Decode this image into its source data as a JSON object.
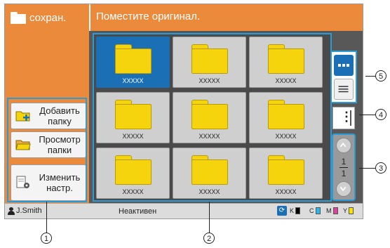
{
  "header": {
    "box_title": "сохран.",
    "message": "Поместите оригинал."
  },
  "sidebar": {
    "buttons": [
      {
        "label": "Добавить папку",
        "icon": "folder-add-icon"
      },
      {
        "label": "Просмотр папки",
        "icon": "folder-open-icon"
      },
      {
        "label": "Изменить настр.",
        "icon": "settings-document-icon"
      }
    ]
  },
  "folders": [
    {
      "name": "XXXXX",
      "selected": true
    },
    {
      "name": "XXXXX",
      "selected": false
    },
    {
      "name": "XXXXX",
      "selected": false
    },
    {
      "name": "XXXXX",
      "selected": false
    },
    {
      "name": "XXXXX",
      "selected": false
    },
    {
      "name": "XXXXX",
      "selected": false
    },
    {
      "name": "XXXXX",
      "selected": false
    },
    {
      "name": "XXXXX",
      "selected": false
    },
    {
      "name": "XXXXX",
      "selected": false
    }
  ],
  "view": {
    "thumbnail_icon": "grid-view-icon",
    "list_icon": "list-view-icon",
    "more_icon": "more-options-icon"
  },
  "pager": {
    "current": "1",
    "total": "1"
  },
  "status_bar": {
    "user": "J.Smith",
    "status": "Неактивен",
    "inks": [
      "K",
      "C",
      "M",
      "Y"
    ],
    "ink_colors": [
      "#000000",
      "#2cb5e8",
      "#e0409a",
      "#f5e400"
    ]
  },
  "callouts": [
    "1",
    "2",
    "3",
    "4",
    "5"
  ],
  "colors": {
    "accent": "#ec8a3c",
    "selection": "#1a6fb5",
    "highlight": "#2b9bd5",
    "folder": "#f6d40d"
  }
}
